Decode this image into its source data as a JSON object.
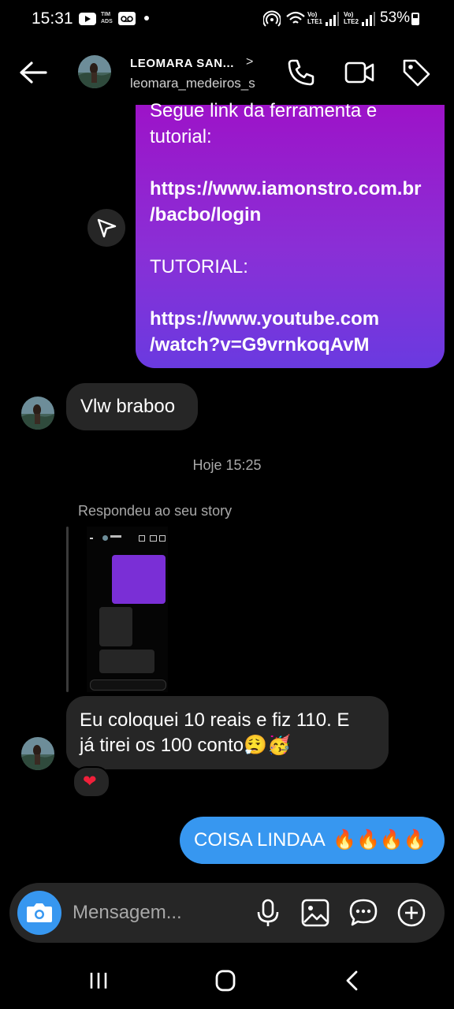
{
  "status_bar": {
    "time": "15:31",
    "carrier_badge": "TIM\nADS",
    "signal_label_1": "Vo)\nLTE1",
    "signal_label_2": "Vo)\nLTE2",
    "battery_percent": "53%"
  },
  "header": {
    "name": "LEOMARA SAN...",
    "username": "leomara_medeiros_s",
    "chevron": ">"
  },
  "messages": {
    "sent_partial": {
      "line1": "Segue link da  ferramenta e",
      "line2": "tutorial:",
      "link1_a": "https://www.iamonstro.com.br",
      "link1_b": "/bacbo/login",
      "tutorial_label": "TUTORIAL:",
      "link2_a": "https://www.youtube.com",
      "link2_b": "/watch?v=G9vrnkoqAvM"
    },
    "received_1": "Vlw braboo",
    "timestamp": "Hoje 15:25",
    "replied_label": "Respondeu ao seu story",
    "received_2_line1": "Eu coloquei 10 reais e fiz 110. E",
    "received_2_line2": "já tirei os 100 conto😮‍💨🥳",
    "reaction": "❤",
    "sent_final": "COISA LINDAA",
    "sent_final_emoji": "🔥🔥🔥🔥"
  },
  "composer": {
    "placeholder": "Mensagem..."
  },
  "icons": {
    "back": "back-arrow-icon",
    "call": "phone-icon",
    "video": "video-camera-icon",
    "tag": "tag-icon",
    "share": "send-icon",
    "camera": "camera-icon",
    "mic": "microphone-icon",
    "gallery": "image-icon",
    "sticker": "chat-sticker-icon",
    "plus": "plus-circle-icon"
  },
  "colors": {
    "background": "#000000",
    "bubble_received": "#262626",
    "bubble_sent_blue": "#3797f0",
    "bubble_sent_gradient_top": "#9d13c8",
    "bubble_sent_gradient_bottom": "#6a3ae0",
    "heart": "#f0203a"
  }
}
